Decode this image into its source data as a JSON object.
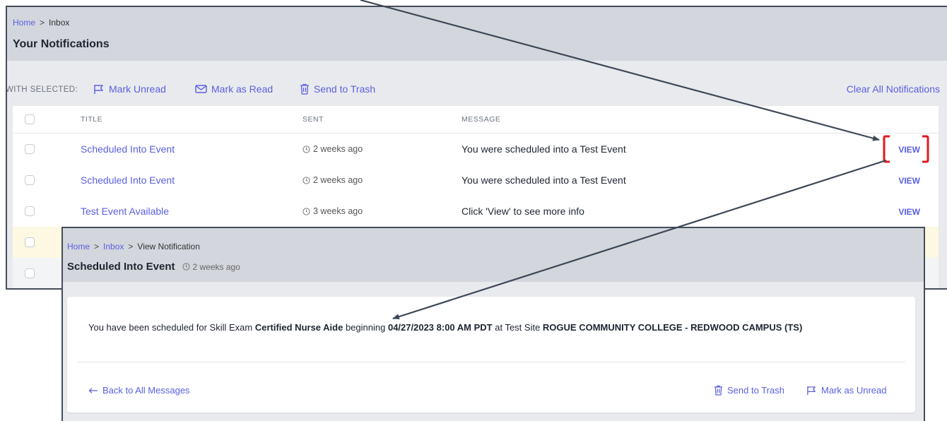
{
  "back_panel": {
    "breadcrumb": {
      "home": "Home",
      "current": "Inbox"
    },
    "title": "Your Notifications",
    "toolbar": {
      "with_selected": "WITH SELECTED:",
      "mark_unread": "Mark Unread",
      "mark_read": "Mark as Read",
      "send_trash": "Send to Trash",
      "clear_all": "Clear All Notifications"
    },
    "table": {
      "headers": {
        "title": "TITLE",
        "sent": "SENT",
        "message": "MESSAGE"
      },
      "rows": [
        {
          "title": "Scheduled Into Event",
          "sent": "2 weeks ago",
          "message": "You were scheduled into a Test Event",
          "action": "VIEW"
        },
        {
          "title": "Scheduled Into Event",
          "sent": "2 weeks ago",
          "message": "You were scheduled into a Test Event",
          "action": "VIEW"
        },
        {
          "title": "Test Event Available",
          "sent": "3 weeks ago",
          "message": "Click 'View' to see more info",
          "action": "VIEW"
        }
      ]
    }
  },
  "front_panel": {
    "breadcrumb": {
      "home": "Home",
      "inbox": "Inbox",
      "current": "View Notification"
    },
    "title": "Scheduled Into Event",
    "sent": "2 weeks ago",
    "message": {
      "part1": "You have been scheduled for Skill Exam ",
      "exam": "Certified Nurse Aide",
      "part2": " beginning ",
      "datetime": "04/27/2023 8:00 AM PDT",
      "part3": " at Test Site ",
      "site": "ROGUE COMMUNITY COLLEGE - REDWOOD CAMPUS (TS)"
    },
    "back_link": "Back to All Messages",
    "send_trash": "Send to Trash",
    "mark_unread": "Mark as Unread"
  },
  "colors": {
    "accent": "#5a5fe0",
    "highlight": "#e3191f",
    "arrow": "#3d4756",
    "header_bg": "#d3d6dc"
  }
}
